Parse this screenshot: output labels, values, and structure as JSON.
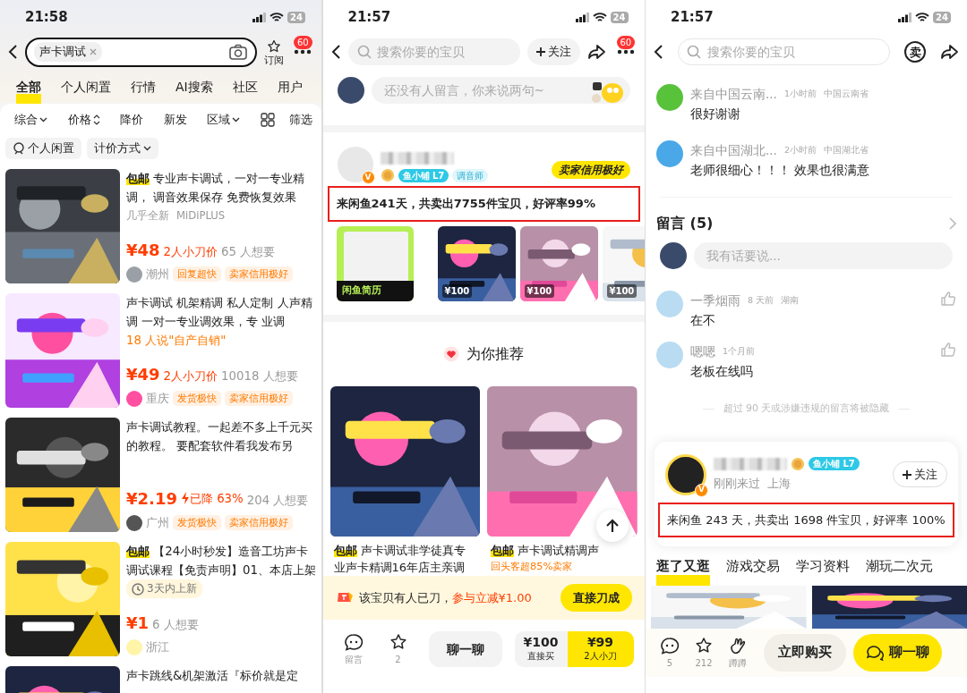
{
  "search_page": {
    "status": {
      "time": "21:58",
      "battery": "24"
    },
    "search": {
      "query": "声卡调试"
    },
    "subscribe": "订阅",
    "badge": "60",
    "tabs": [
      {
        "label": "全部",
        "selected": true
      },
      {
        "label": "个人闲置",
        "selected": false
      },
      {
        "label": "行情",
        "selected": false
      },
      {
        "label": "AI搜索",
        "selected": false
      },
      {
        "label": "社区",
        "selected": false
      },
      {
        "label": "用户",
        "selected": false
      }
    ],
    "sorts": [
      {
        "label": "综合",
        "kind": "dropdown"
      },
      {
        "label": "价格",
        "kind": "sort"
      },
      {
        "label": "降价",
        "kind": "plain"
      },
      {
        "label": "新发",
        "kind": "plain"
      },
      {
        "label": "区域",
        "kind": "dropdown"
      }
    ],
    "filter": "筛选",
    "chips": [
      {
        "label": "个人闲置",
        "kind": "person"
      },
      {
        "label": "计价方式",
        "kind": "menu"
      }
    ],
    "items": [
      {
        "badge": "包邮",
        "title": "专业声卡调试，一对一专业精调， 调音效果保存 免费恢复效果",
        "condition": "几乎全新",
        "brand": "MiDiPLUS",
        "price": "¥48",
        "bargain": "2人小刀价",
        "wants": "65 人想要",
        "location": "潮州",
        "tags": [
          "回复超快",
          "卖家信用极好"
        ]
      },
      {
        "title": "声卡调试 机架精调 私人定制 人声精调 一对一专业调效果，专 业调",
        "note": "18 人说\"自产自销\"",
        "price": "¥49",
        "bargain": "2人小刀价",
        "wants": "10018 人想要",
        "location": "重庆",
        "tags": [
          "发货极快",
          "卖家信用极好"
        ]
      },
      {
        "title": "声卡调试教程。一起差不多上千元买的教程。 要配套软件看我发布另",
        "price": "¥2.19",
        "drop": "已降 63%",
        "wants": "204 人想要",
        "location": "广州",
        "tags": [
          "发货极快",
          "卖家信用极好"
        ]
      },
      {
        "badge": "包邮",
        "title": "【24小时秒发】造音工坊声卡调试课程【免责声明】01、本店上架",
        "new_note": "3天内上新",
        "price": "¥1",
        "wants": "6 人想要",
        "location": "浙江"
      },
      {
        "title": "声卡跳线&机架激活『标价就是定"
      }
    ]
  },
  "item_page": {
    "status": {
      "time": "21:57",
      "battery": "24"
    },
    "search": {
      "placeholder": "搜索你要的宝贝"
    },
    "follow": "关注",
    "badge": "60",
    "comment": {
      "placeholder": "还没有人留言，你来说两句~"
    },
    "seller": {
      "verified": "V",
      "level": "鱼小铺 L7",
      "role": "调音师",
      "credit": "卖家信用极好",
      "stats": "来闲鱼241天，共卖出7755件宝贝，好评率99%"
    },
    "showcase": [
      {
        "kind": "resume",
        "label": "闲鱼简历"
      },
      {
        "kind": "product",
        "price": "¥100"
      },
      {
        "kind": "product",
        "price": "¥100"
      },
      {
        "kind": "product",
        "price": "¥100"
      }
    ],
    "recommend_title": "为你推荐",
    "recommend": [
      {
        "badge": "包邮",
        "title": "声卡调试非学徒真专业声卡精调16年店主亲调"
      },
      {
        "badge": "包邮",
        "title": "声卡调试精调声",
        "note": "回头客超85%卖家"
      }
    ],
    "bargain": {
      "text": "该宝贝有人已刀，",
      "offer": "参与立减¥1.00",
      "button": "直接刀成"
    },
    "actions": [
      {
        "kind": "comment",
        "label": "留言"
      },
      {
        "kind": "star",
        "label": "2"
      }
    ],
    "chat": "聊一聊",
    "buy": [
      {
        "price": "¥100",
        "label": "直接买",
        "kind": "plain"
      },
      {
        "price": "¥99",
        "label": "2人小刀",
        "kind": "accent"
      }
    ]
  },
  "comments_page": {
    "status": {
      "time": "21:57",
      "battery": "24"
    },
    "search": {
      "placeholder": "搜索你要的宝贝"
    },
    "sell_icon": "卖",
    "reviews": [
      {
        "name": "来自中国云南...",
        "time": "1小时前",
        "region": "中国云南省",
        "text": "很好谢谢",
        "color": "#58c23a"
      },
      {
        "name": "来自中国湖北...",
        "time": "2小时前",
        "region": "中国湖北省",
        "text": "老师很细心！！！ 效果也很满意",
        "color": "#4aa8e8"
      }
    ],
    "comments_title": "留言 (5)",
    "comment_input": {
      "placeholder": "我有话要说..."
    },
    "comments": [
      {
        "name": "一季烟雨",
        "time": "8 天前",
        "region": "湖南",
        "text": "在不"
      },
      {
        "name": "嗯嗯",
        "time": "1个月前",
        "text": "老板在线吗"
      }
    ],
    "notice": "超过 90 天或涉嫌违规的留言将被隐藏",
    "seller": {
      "verified": "V",
      "level": "鱼小铺 L7",
      "follow": "关注",
      "visited": "刚刚来过",
      "city": "上海",
      "stats": "来闲鱼 243 天，共卖出 1698 件宝贝，好评率 100%"
    },
    "tabs": [
      {
        "label": "逛了又逛",
        "selected": true
      },
      {
        "label": "游戏交易",
        "selected": false
      },
      {
        "label": "学习资料",
        "selected": false
      },
      {
        "label": "潮玩二次元",
        "selected": false
      }
    ],
    "actions": [
      {
        "kind": "comment",
        "label": "5"
      },
      {
        "kind": "star",
        "label": "212"
      },
      {
        "kind": "hand",
        "label": "蹲蹲"
      }
    ],
    "buy": "立即购买",
    "chat": "聊一聊"
  }
}
